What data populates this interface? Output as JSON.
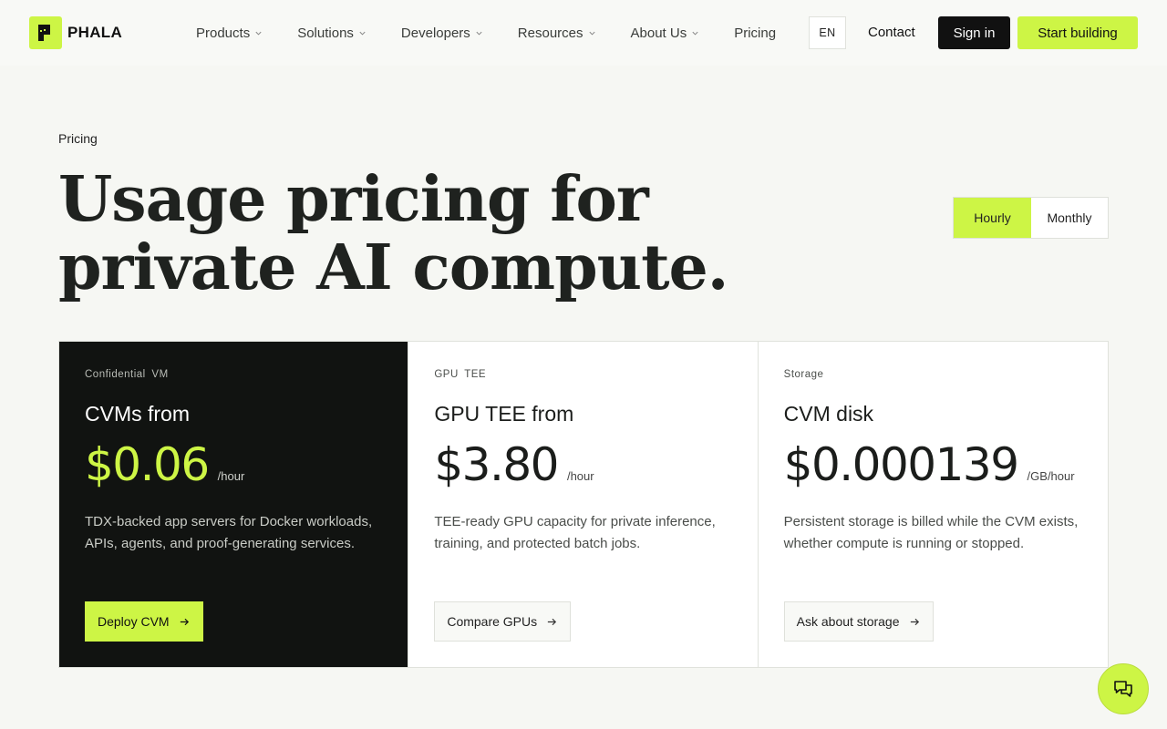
{
  "brand": {
    "name": "PHALA",
    "accent": "#cdf545",
    "dark": "#111311"
  },
  "nav": {
    "items": [
      {
        "label": "Products",
        "has_menu": true
      },
      {
        "label": "Solutions",
        "has_menu": true
      },
      {
        "label": "Developers",
        "has_menu": true
      },
      {
        "label": "Resources",
        "has_menu": true
      },
      {
        "label": "About Us",
        "has_menu": true
      },
      {
        "label": "Pricing",
        "has_menu": false
      }
    ],
    "language": "EN",
    "contact": "Contact",
    "sign_in": "Sign in",
    "start_building": "Start building"
  },
  "hero": {
    "eyebrow": "Pricing",
    "title": "Usage pricing for private AI compute."
  },
  "billing_toggle": {
    "options": [
      "Hourly",
      "Monthly"
    ],
    "selected": "Hourly"
  },
  "cards": [
    {
      "tag": "Confidential VM",
      "heading": "CVMs from",
      "price": "$0.06",
      "unit": "/hour",
      "description": "TDX-backed app servers for Docker workloads, APIs, agents, and proof-generating services.",
      "button": "Deploy CVM"
    },
    {
      "tag": "GPU TEE",
      "heading": "GPU TEE from",
      "price": "$3.80",
      "unit": "/hour",
      "description": "TEE-ready GPU capacity for private inference, training, and protected batch jobs.",
      "button": "Compare GPUs"
    },
    {
      "tag": "Storage",
      "heading": "CVM disk",
      "price": "$0.000139",
      "unit": "/GB/hour",
      "description": "Persistent storage is billed while the CVM exists, whether compute is running or stopped.",
      "button": "Ask about storage"
    }
  ],
  "icons": {
    "logo": "phala-logo-icon",
    "chevron": "chevron-down-icon",
    "arrow": "arrow-right-icon",
    "chat": "chat-icon"
  }
}
